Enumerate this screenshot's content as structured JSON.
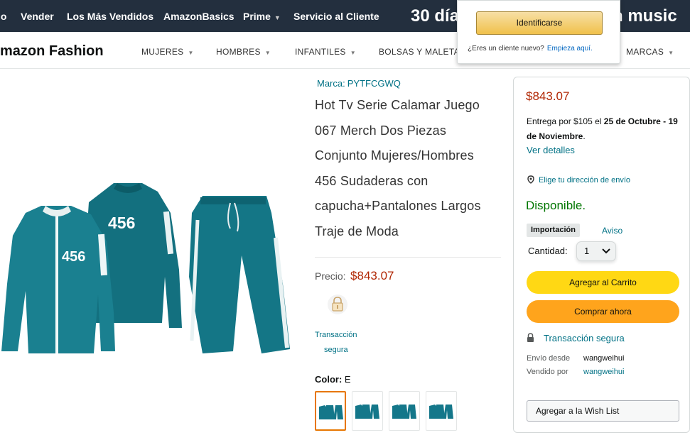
{
  "topnav": {
    "items": [
      {
        "label": "lo",
        "has_caret": false
      },
      {
        "label": "Vender",
        "has_caret": false
      },
      {
        "label": "Los Más Vendidos",
        "has_caret": false
      },
      {
        "label": "AmazonBasics",
        "has_caret": false
      },
      {
        "label": "Prime",
        "has_caret": true
      },
      {
        "label": "Servicio al Cliente",
        "has_caret": false
      }
    ],
    "promo_text": "30 día",
    "music_text": "n music"
  },
  "signin_popover": {
    "button_label": "Identificarse",
    "new_customer_text": "¿Eres un cliente nuevo?",
    "start_link": "Empieza aquí."
  },
  "subnav": {
    "brand_title": "mazon Fashion",
    "categories": [
      "MUJERES",
      "HOMBRES",
      "INFANTILES",
      "BOLSAS Y MALETAS",
      "MARCAS"
    ]
  },
  "product": {
    "brand_label": "Marca:",
    "brand_name": "PYTFCGWQ",
    "title_lines": [
      "Hot Tv Serie Calamar Juego",
      "067 Merch Dos Piezas",
      "Conjunto Mujeres/Hombres",
      "456 Sudaderas con",
      "capucha+Pantalones Largos",
      "Traje de Moda"
    ],
    "jersey_number": "456",
    "price_label": "Precio:",
    "price": "$843.07",
    "secure_line1": "Transacción",
    "secure_line2": "segura",
    "color_label": "Color:",
    "color_value": "E",
    "swatch_count": 4,
    "selected_swatch": 1
  },
  "buybox": {
    "price": "$843.07",
    "delivery_prefix": "Entrega por $105 el",
    "delivery_dates": "25 de Octubre - 19 de Noviembre",
    "delivery_suffix": ".",
    "details_link": "Ver detalles",
    "address_link": "Elige tu dirección de envío",
    "availability": "Disponible.",
    "import_badge": "Importación",
    "notice_link": "Aviso",
    "quantity_label": "Cantidad:",
    "quantity_value": "1",
    "add_to_cart": "Agregar al Carrito",
    "buy_now": "Comprar ahora",
    "secure_text": "Transacción segura",
    "ships_from_label": "Envío desde",
    "ships_from_value": "wangweihui",
    "sold_by_label": "Vendido por",
    "sold_by_value": "wangweihui",
    "wishlist": "Agregar a la Wish List"
  },
  "colors": {
    "nav_bg": "#232f3e",
    "teal_garment": "#14778a",
    "price_red": "#b12704",
    "link_teal": "#007185",
    "available_green": "#007600",
    "cart_yellow": "#ffd814",
    "buy_orange": "#ffa41c",
    "selected_border": "#e77600"
  }
}
